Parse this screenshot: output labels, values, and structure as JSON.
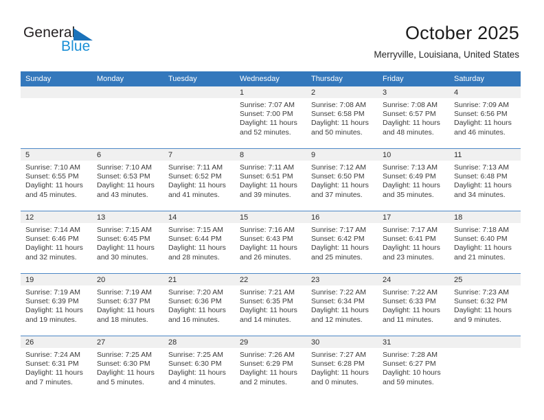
{
  "logo": {
    "primary_text": "General",
    "secondary_text": "Blue",
    "primary_color": "#231f20",
    "secondary_color": "#1a8fd6",
    "triangle_color": "#1a72ba"
  },
  "header": {
    "title": "October 2025",
    "subtitle": "Merryville, Louisiana, United States"
  },
  "theme": {
    "header_bg": "#3478bc",
    "header_text": "#ffffff",
    "daynum_band_bg": "#f0f0f0",
    "row_divider": "#4a86c5",
    "body_text": "#3a3a3a"
  },
  "weekday_headers": [
    "Sunday",
    "Monday",
    "Tuesday",
    "Wednesday",
    "Thursday",
    "Friday",
    "Saturday"
  ],
  "weeks": [
    [
      {
        "day": "",
        "lines": []
      },
      {
        "day": "",
        "lines": []
      },
      {
        "day": "",
        "lines": []
      },
      {
        "day": "1",
        "lines": [
          "Sunrise: 7:07 AM",
          "Sunset: 7:00 PM",
          "Daylight: 11 hours",
          "and 52 minutes."
        ]
      },
      {
        "day": "2",
        "lines": [
          "Sunrise: 7:08 AM",
          "Sunset: 6:58 PM",
          "Daylight: 11 hours",
          "and 50 minutes."
        ]
      },
      {
        "day": "3",
        "lines": [
          "Sunrise: 7:08 AM",
          "Sunset: 6:57 PM",
          "Daylight: 11 hours",
          "and 48 minutes."
        ]
      },
      {
        "day": "4",
        "lines": [
          "Sunrise: 7:09 AM",
          "Sunset: 6:56 PM",
          "Daylight: 11 hours",
          "and 46 minutes."
        ]
      }
    ],
    [
      {
        "day": "5",
        "lines": [
          "Sunrise: 7:10 AM",
          "Sunset: 6:55 PM",
          "Daylight: 11 hours",
          "and 45 minutes."
        ]
      },
      {
        "day": "6",
        "lines": [
          "Sunrise: 7:10 AM",
          "Sunset: 6:53 PM",
          "Daylight: 11 hours",
          "and 43 minutes."
        ]
      },
      {
        "day": "7",
        "lines": [
          "Sunrise: 7:11 AM",
          "Sunset: 6:52 PM",
          "Daylight: 11 hours",
          "and 41 minutes."
        ]
      },
      {
        "day": "8",
        "lines": [
          "Sunrise: 7:11 AM",
          "Sunset: 6:51 PM",
          "Daylight: 11 hours",
          "and 39 minutes."
        ]
      },
      {
        "day": "9",
        "lines": [
          "Sunrise: 7:12 AM",
          "Sunset: 6:50 PM",
          "Daylight: 11 hours",
          "and 37 minutes."
        ]
      },
      {
        "day": "10",
        "lines": [
          "Sunrise: 7:13 AM",
          "Sunset: 6:49 PM",
          "Daylight: 11 hours",
          "and 35 minutes."
        ]
      },
      {
        "day": "11",
        "lines": [
          "Sunrise: 7:13 AM",
          "Sunset: 6:48 PM",
          "Daylight: 11 hours",
          "and 34 minutes."
        ]
      }
    ],
    [
      {
        "day": "12",
        "lines": [
          "Sunrise: 7:14 AM",
          "Sunset: 6:46 PM",
          "Daylight: 11 hours",
          "and 32 minutes."
        ]
      },
      {
        "day": "13",
        "lines": [
          "Sunrise: 7:15 AM",
          "Sunset: 6:45 PM",
          "Daylight: 11 hours",
          "and 30 minutes."
        ]
      },
      {
        "day": "14",
        "lines": [
          "Sunrise: 7:15 AM",
          "Sunset: 6:44 PM",
          "Daylight: 11 hours",
          "and 28 minutes."
        ]
      },
      {
        "day": "15",
        "lines": [
          "Sunrise: 7:16 AM",
          "Sunset: 6:43 PM",
          "Daylight: 11 hours",
          "and 26 minutes."
        ]
      },
      {
        "day": "16",
        "lines": [
          "Sunrise: 7:17 AM",
          "Sunset: 6:42 PM",
          "Daylight: 11 hours",
          "and 25 minutes."
        ]
      },
      {
        "day": "17",
        "lines": [
          "Sunrise: 7:17 AM",
          "Sunset: 6:41 PM",
          "Daylight: 11 hours",
          "and 23 minutes."
        ]
      },
      {
        "day": "18",
        "lines": [
          "Sunrise: 7:18 AM",
          "Sunset: 6:40 PM",
          "Daylight: 11 hours",
          "and 21 minutes."
        ]
      }
    ],
    [
      {
        "day": "19",
        "lines": [
          "Sunrise: 7:19 AM",
          "Sunset: 6:39 PM",
          "Daylight: 11 hours",
          "and 19 minutes."
        ]
      },
      {
        "day": "20",
        "lines": [
          "Sunrise: 7:19 AM",
          "Sunset: 6:37 PM",
          "Daylight: 11 hours",
          "and 18 minutes."
        ]
      },
      {
        "day": "21",
        "lines": [
          "Sunrise: 7:20 AM",
          "Sunset: 6:36 PM",
          "Daylight: 11 hours",
          "and 16 minutes."
        ]
      },
      {
        "day": "22",
        "lines": [
          "Sunrise: 7:21 AM",
          "Sunset: 6:35 PM",
          "Daylight: 11 hours",
          "and 14 minutes."
        ]
      },
      {
        "day": "23",
        "lines": [
          "Sunrise: 7:22 AM",
          "Sunset: 6:34 PM",
          "Daylight: 11 hours",
          "and 12 minutes."
        ]
      },
      {
        "day": "24",
        "lines": [
          "Sunrise: 7:22 AM",
          "Sunset: 6:33 PM",
          "Daylight: 11 hours",
          "and 11 minutes."
        ]
      },
      {
        "day": "25",
        "lines": [
          "Sunrise: 7:23 AM",
          "Sunset: 6:32 PM",
          "Daylight: 11 hours",
          "and 9 minutes."
        ]
      }
    ],
    [
      {
        "day": "26",
        "lines": [
          "Sunrise: 7:24 AM",
          "Sunset: 6:31 PM",
          "Daylight: 11 hours",
          "and 7 minutes."
        ]
      },
      {
        "day": "27",
        "lines": [
          "Sunrise: 7:25 AM",
          "Sunset: 6:30 PM",
          "Daylight: 11 hours",
          "and 5 minutes."
        ]
      },
      {
        "day": "28",
        "lines": [
          "Sunrise: 7:25 AM",
          "Sunset: 6:30 PM",
          "Daylight: 11 hours",
          "and 4 minutes."
        ]
      },
      {
        "day": "29",
        "lines": [
          "Sunrise: 7:26 AM",
          "Sunset: 6:29 PM",
          "Daylight: 11 hours",
          "and 2 minutes."
        ]
      },
      {
        "day": "30",
        "lines": [
          "Sunrise: 7:27 AM",
          "Sunset: 6:28 PM",
          "Daylight: 11 hours",
          "and 0 minutes."
        ]
      },
      {
        "day": "31",
        "lines": [
          "Sunrise: 7:28 AM",
          "Sunset: 6:27 PM",
          "Daylight: 10 hours",
          "and 59 minutes."
        ]
      },
      {
        "day": "",
        "lines": []
      }
    ]
  ]
}
